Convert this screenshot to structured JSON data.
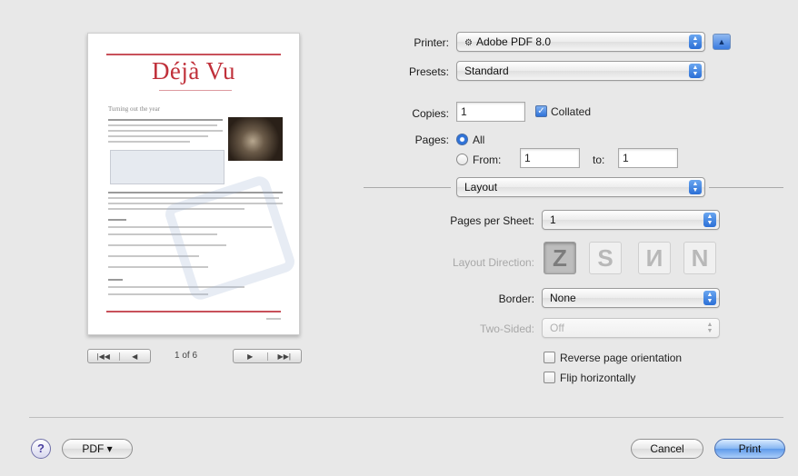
{
  "preview": {
    "doc_title": "Déjà Vu",
    "doc_subtitle": "Turning out the year",
    "page_indicator": "1 of 6",
    "nav_first": "|◀◀",
    "nav_prev": "◀",
    "nav_next": "▶",
    "nav_last": "▶▶|"
  },
  "printer": {
    "label": "Printer:",
    "value": "Adobe PDF 8.0"
  },
  "presets": {
    "label": "Presets:",
    "value": "Standard"
  },
  "copies": {
    "label": "Copies:",
    "value": "1",
    "collated_label": "Collated",
    "collated": true
  },
  "pages": {
    "label": "Pages:",
    "all_label": "All",
    "from_label": "From:",
    "from_value": "1",
    "to_label": "to:",
    "to_value": "1",
    "selected": "all"
  },
  "section_popup": {
    "value": "Layout"
  },
  "layout": {
    "pages_per_sheet_label": "Pages per Sheet:",
    "pages_per_sheet_value": "1",
    "layout_direction_label": "Layout Direction:",
    "directions": [
      "Z",
      "S",
      "И",
      "N"
    ],
    "border_label": "Border:",
    "border_value": "None",
    "two_sided_label": "Two-Sided:",
    "two_sided_value": "Off",
    "reverse_label": "Reverse page orientation",
    "flip_label": "Flip horizontally"
  },
  "footer": {
    "help_label": "?",
    "pdf_label": "PDF ▾",
    "cancel_label": "Cancel",
    "print_label": "Print"
  },
  "icons": {
    "stepper": "up-down-arrows-icon",
    "collapse": "disclosure-up-icon",
    "printer_badge": "printer-icon"
  }
}
